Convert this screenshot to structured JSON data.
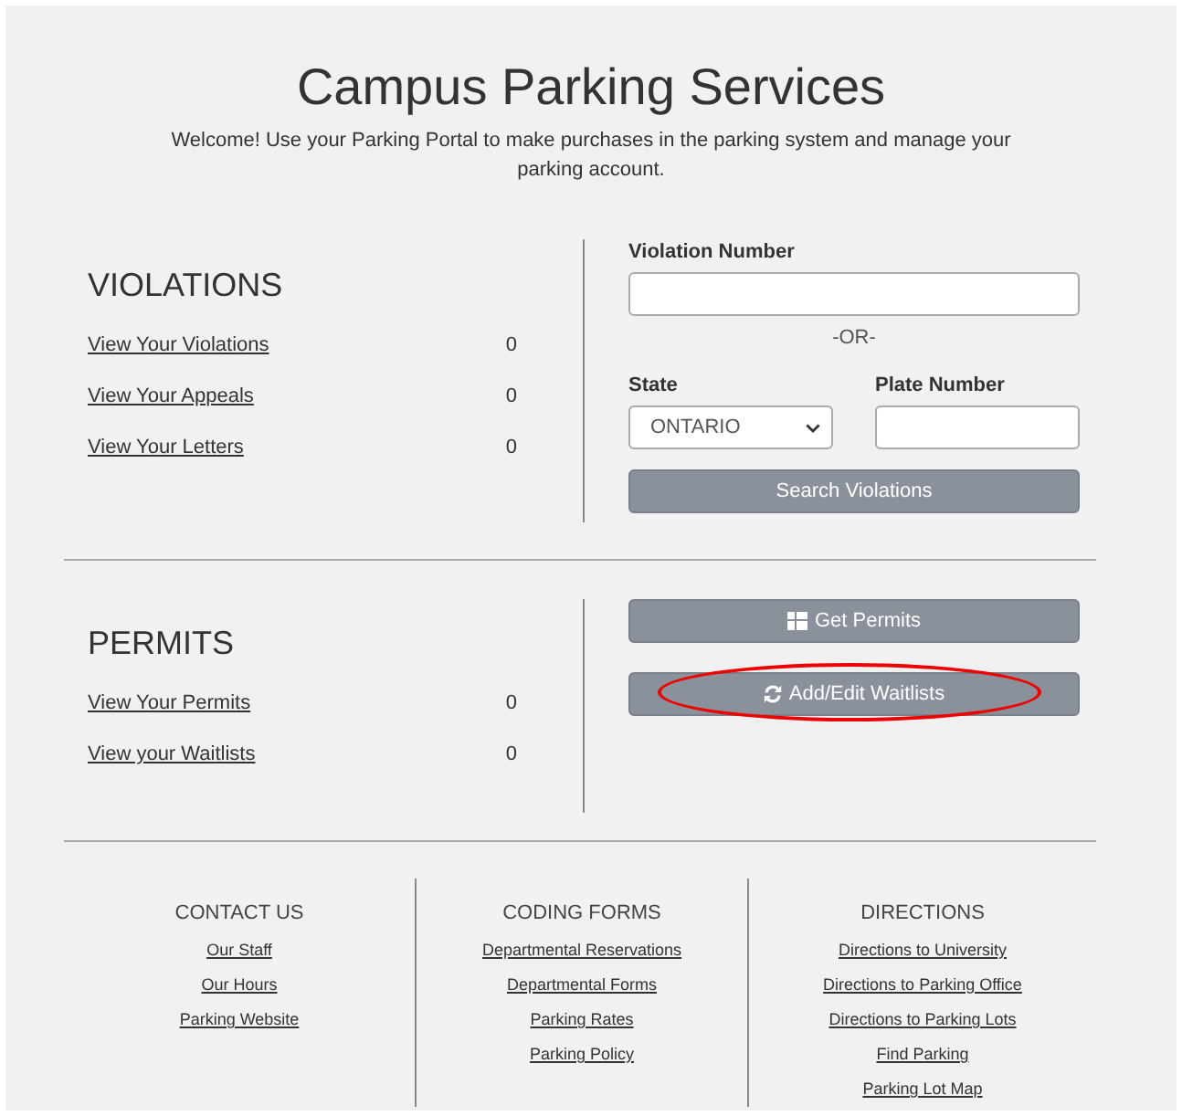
{
  "title": "Campus Parking Services",
  "intro": "Welcome! Use your Parking Portal to make purchases in the parking system and manage your parking account.",
  "violations": {
    "heading": "VIOLATIONS",
    "links": [
      {
        "label": "View Your Violations",
        "count": "0"
      },
      {
        "label": "View Your Appeals",
        "count": "0"
      },
      {
        "label": "View Your Letters",
        "count": "0"
      }
    ]
  },
  "violation_search": {
    "violation_number_label": "Violation Number",
    "or_text": "-OR-",
    "state_label": "State",
    "state_value": "ONTARIO",
    "plate_label": "Plate Number",
    "button": "Search Violations"
  },
  "permits": {
    "heading": "PERMITS",
    "links": [
      {
        "label": "View Your Permits",
        "count": "0"
      },
      {
        "label": "View your Waitlists",
        "count": "0"
      }
    ],
    "buttons": [
      {
        "label": "Get Permits",
        "highlighted": false
      },
      {
        "label": "Add/Edit Waitlists",
        "highlighted": true
      }
    ]
  },
  "footer": {
    "columns": [
      {
        "heading": "CONTACT US",
        "links": [
          "Our Staff",
          "Our Hours",
          "Parking Website"
        ]
      },
      {
        "heading": "CODING FORMS",
        "links": [
          "Departmental Reservations",
          "Departmental Forms",
          "Parking Rates",
          "Parking Policy"
        ]
      },
      {
        "heading": "DIRECTIONS",
        "links": [
          "Directions to University",
          "Directions to Parking Office",
          "Directions to Parking Lots",
          "Find Parking",
          "Parking Lot Map"
        ]
      }
    ]
  }
}
